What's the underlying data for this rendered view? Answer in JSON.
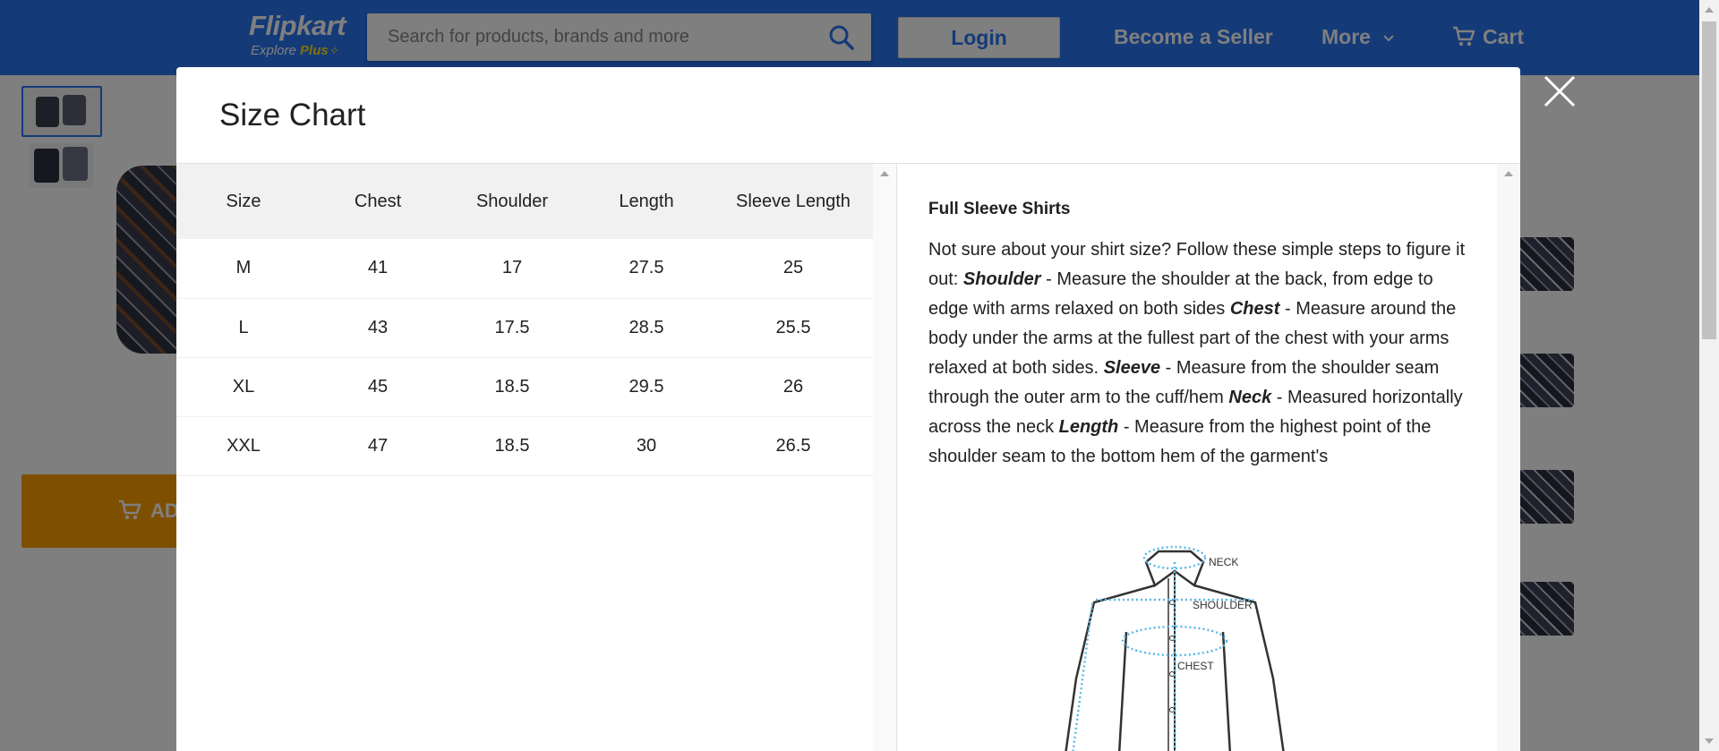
{
  "header": {
    "logo_main": "Flipkart",
    "logo_sub_explore": "Explore ",
    "logo_sub_plus": "Plus",
    "search_placeholder": "Search for products, brands and more",
    "login_label": "Login",
    "become_seller_label": "Become a Seller",
    "more_label": "More",
    "cart_label": "Cart",
    "brand_color": "#2874f0"
  },
  "page": {
    "add_to_cart_label": "ADD",
    "add_to_cart_color": "#ff9f00"
  },
  "modal": {
    "title": "Size Chart",
    "table": {
      "columns": [
        "Size",
        "Chest",
        "Shoulder",
        "Length",
        "Sleeve Length"
      ],
      "rows": [
        [
          "M",
          "41",
          "17",
          "27.5",
          "25"
        ],
        [
          "L",
          "43",
          "17.5",
          "28.5",
          "25.5"
        ],
        [
          "XL",
          "45",
          "18.5",
          "29.5",
          "26"
        ],
        [
          "XXL",
          "47",
          "18.5",
          "30",
          "26.5"
        ]
      ]
    },
    "guide": {
      "title": "Full Sleeve Shirts",
      "intro": "Not sure about your shirt size? Follow these simple steps to figure it out: ",
      "steps": [
        {
          "term": "Shoulder",
          "text": " - Measure the shoulder at the back, from edge to edge with arms relaxed on both sides "
        },
        {
          "term": "Chest",
          "text": " - Measure around the body under the arms at the fullest part of the chest with your arms relaxed at both sides. "
        },
        {
          "term": "Sleeve",
          "text": " - Measure from the shoulder seam through the outer arm to the cuff/hem "
        },
        {
          "term": "Neck",
          "text": " - Measured horizontally across the neck "
        },
        {
          "term": "Length",
          "text": " - Measure from the highest point of the shoulder seam to the bottom hem of the garment's"
        }
      ],
      "figure_labels": {
        "neck": "NECK",
        "shoulder": "SHOULDER",
        "chest": "CHEST"
      }
    }
  }
}
